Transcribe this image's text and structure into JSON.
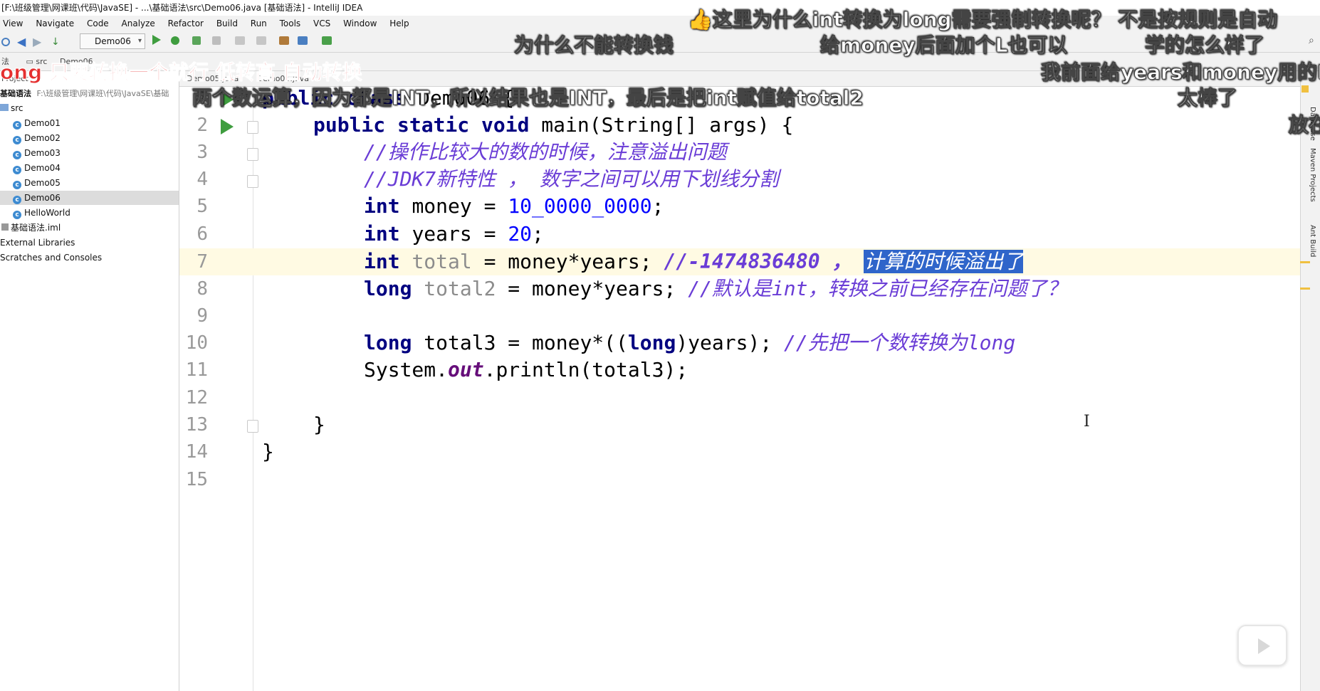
{
  "window": {
    "title": "[F:\\班级管理\\网课班\\代码\\JavaSE] - ...\\基础语法\\src\\Demo06.java [基础语法] - IntelliJ IDEA"
  },
  "menu": [
    "View",
    "Navigate",
    "Code",
    "Analyze",
    "Refactor",
    "Build",
    "Run",
    "Tools",
    "VCS",
    "Window",
    "Help"
  ],
  "toolbar": {
    "run_config": "Demo06"
  },
  "navbar": {
    "crumb_root": "法",
    "crumb_src": "src",
    "crumb_file": "Demo06"
  },
  "editor_tabs": [
    "Demo05.java",
    "Demo06.java"
  ],
  "project": {
    "header_label": "Project",
    "root_name": "基础语法",
    "root_path": "F:\\班级管理\\网课班\\代码\\JavaSE\\基础",
    "src": "src",
    "files": [
      "Demo01",
      "Demo02",
      "Demo03",
      "Demo04",
      "Demo05",
      "Demo06",
      "HelloWorld"
    ],
    "iml": "基础语法.iml",
    "external": "External Libraries",
    "scratches": "Scratches and Consoles"
  },
  "code": {
    "line_numbers": [
      "1",
      "2",
      "3",
      "4",
      "5",
      "6",
      "7",
      "8",
      "9",
      "10",
      "11",
      "12",
      "13",
      "14",
      "15"
    ],
    "l1": {
      "kw1": "public",
      "kw2": "class",
      "name": "Demo06",
      "brace": "{"
    },
    "l2": {
      "kw": "public static void",
      "rest": "main(String[] args) {"
    },
    "l3": "//操作比较大的数的时候，注意溢出问题",
    "l4": "//JDK7新特性 ， 数字之间可以用下划线分割",
    "l5": {
      "kw": "int",
      "var": "money",
      "eq": "=",
      "num": "10_0000_0000",
      "semi": ";"
    },
    "l6": {
      "kw": "int",
      "var": "years",
      "eq": "=",
      "num": "20",
      "semi": ";"
    },
    "l7": {
      "kw": "int",
      "var": "total",
      "rest": "= money*years;",
      "comment": "//-1474836480 ，",
      "selected": "计算的时候溢出了"
    },
    "l8": {
      "kw": "long",
      "var": "total2",
      "rest": " = money*years;",
      "comment": "//默认是int，转换之前已经存在问题了？"
    },
    "l10": {
      "kw": "long",
      "rest1": "total3 = money*((",
      "kw2": "long",
      "rest2": ")years);",
      "comment": "//先把一个数转换为long"
    },
    "l11": {
      "pre": "System.",
      "out": "out",
      "post": ".println(total3);"
    },
    "l13": "}",
    "l14": "}"
  },
  "side_tools": [
    "Database",
    "Maven Projects",
    "Ant Build"
  ],
  "danmaku": {
    "d1": "👍这里为什么int转换为long需要强制转换呢？ 不是按规则是自动",
    "d2": "为什么不能转换钱",
    "d3": "给money后面加个L也可以",
    "d4": "学的怎么样了",
    "d5": "ong   只要转换一个就行  低转高  自动转换",
    "d6": "我前面给years和money用的L",
    "d7": "两个数运算，因为都是INT，所以结果也是INT，最后是把int赋值给total2",
    "d8": "太棒了",
    "d9": "放在"
  }
}
